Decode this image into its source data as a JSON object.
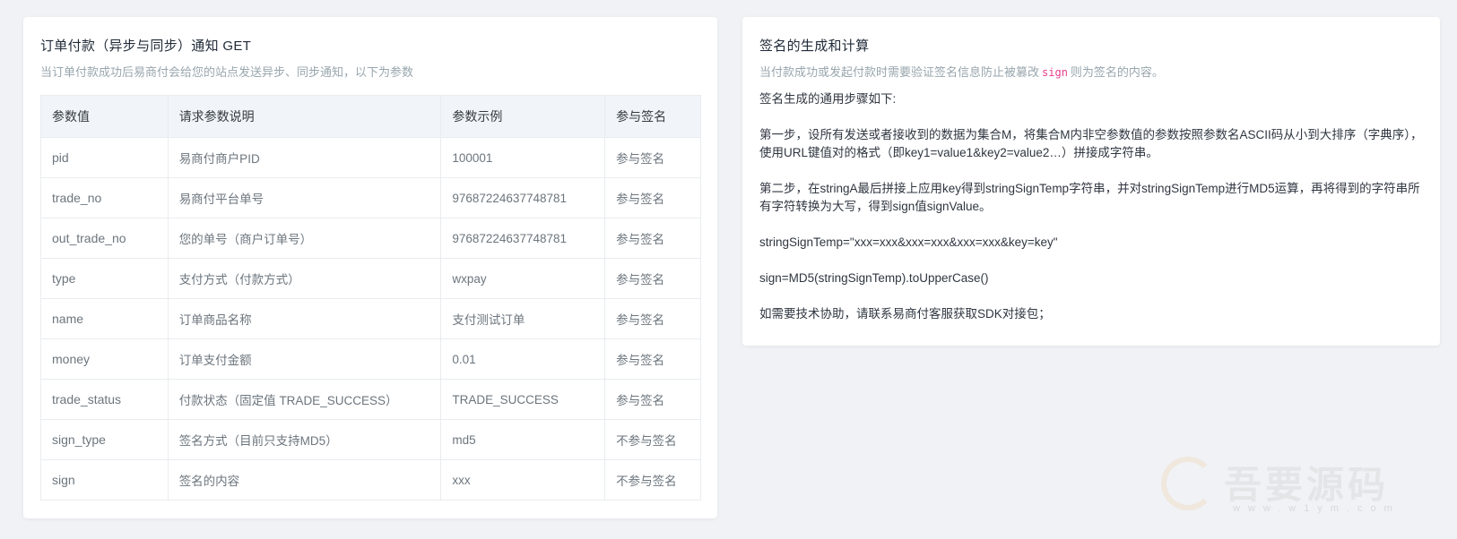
{
  "left": {
    "title": "订单付款（异步与同步）通知 GET",
    "subtitle": "当订单付款成功后易商付会给您的站点发送异步、同步通知，以下为参数",
    "headers": [
      "参数值",
      "请求参数说明",
      "参数示例",
      "参与签名"
    ],
    "rows": [
      [
        "pid",
        "易商付商户PID",
        "100001",
        "参与签名"
      ],
      [
        "trade_no",
        "易商付平台单号",
        "97687224637748781",
        "参与签名"
      ],
      [
        "out_trade_no",
        "您的单号（商户订单号）",
        "97687224637748781",
        "参与签名"
      ],
      [
        "type",
        "支付方式（付款方式）",
        "wxpay",
        "参与签名"
      ],
      [
        "name",
        "订单商品名称",
        "支付测试订单",
        "参与签名"
      ],
      [
        "money",
        "订单支付金额",
        "0.01",
        "参与签名"
      ],
      [
        "trade_status",
        "付款状态（固定值 TRADE_SUCCESS）",
        "TRADE_SUCCESS",
        "参与签名"
      ],
      [
        "sign_type",
        "签名方式（目前只支持MD5）",
        "md5",
        "不参与签名"
      ],
      [
        "sign",
        "签名的内容",
        "xxx",
        "不参与签名"
      ]
    ]
  },
  "right": {
    "title": "签名的生成和计算",
    "subtitle_pre": "当付款成功或发起付款时需要验证签名信息防止被篡改",
    "subtitle_code": "sign",
    "subtitle_post": "则为签名的内容。",
    "intro": "签名生成的通用步骤如下:",
    "step1": "第一步，设所有发送或者接收到的数据为集合M，将集合M内非空参数值的参数按照参数名ASCII码从小到大排序（字典序），使用URL键值对的格式（即key1=value1&key2=value2…）拼接成字符串。",
    "step2": "第二步，在stringA最后拼接上应用key得到stringSignTemp字符串，并对stringSignTemp进行MD5运算，再将得到的字符串所有字符转换为大写，得到sign值signValue。",
    "formula1": "stringSignTemp=\"xxx=xxx&xxx=xxx&xxx=xxx&key=key\"",
    "formula2": "sign=MD5(stringSignTemp).toUpperCase()",
    "help": "如需要技术协助，请联系易商付客服获取SDK对接包；"
  },
  "watermark": {
    "text": "吾要源码",
    "url": "www.w1ym.com"
  }
}
